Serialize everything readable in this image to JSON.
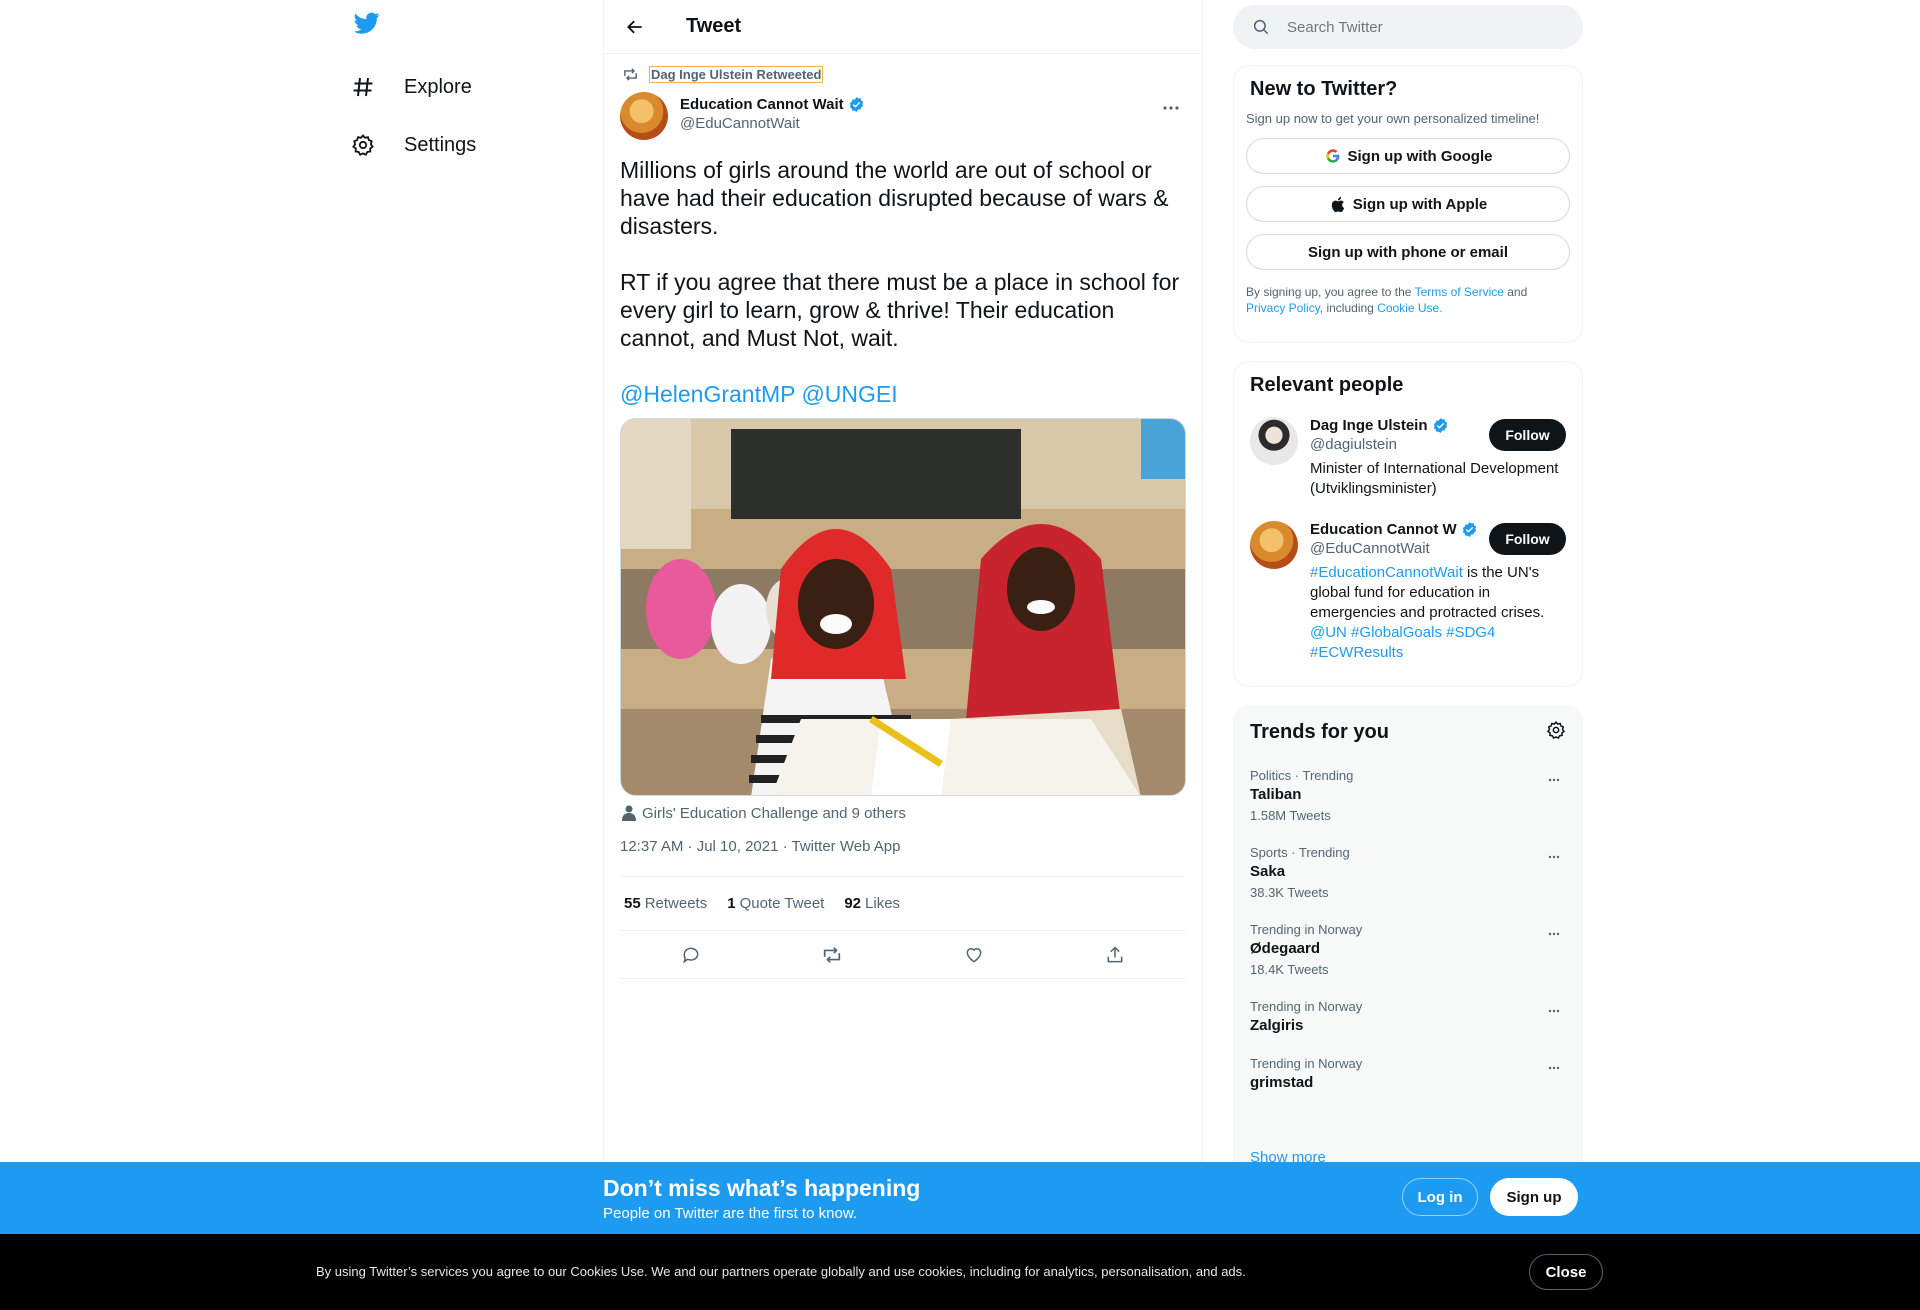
{
  "colors": {
    "accent": "#1d9bf0",
    "text": "#0f1419",
    "muted": "#536471"
  },
  "nav": {
    "logo_icon": "twitter-bird-icon",
    "items": [
      {
        "label": "Explore",
        "icon": "hashtag-icon"
      },
      {
        "label": "Settings",
        "icon": "gear-icon"
      }
    ]
  },
  "header": {
    "title": "Tweet",
    "back_icon": "arrow-left-icon"
  },
  "tweet": {
    "retweeted_by": "Dag Inge Ulstein Retweeted",
    "author_name": "Education Cannot Wait",
    "author_handle": "@EduCannotWait",
    "text": "Millions of girls around the world are out of school or have had their education disrupted because of wars & disasters.\n\nRT if you agree that there must be a place in school for every girl to learn, grow & thrive! Their education cannot, and Must Not, wait.",
    "mentions": [
      "@HelenGrantMP",
      "@UNGEI"
    ],
    "tagged": "Girls' Education Challenge and 9 others",
    "timestamp": "12:37 AM · Jul 10, 2021 · Twitter Web App",
    "stats": {
      "retweets_count": "55",
      "retweets_label": "Retweets",
      "quotes_count": "1",
      "quotes_label": "Quote Tweet",
      "likes_count": "92",
      "likes_label": "Likes"
    }
  },
  "search": {
    "placeholder": "Search Twitter"
  },
  "new_to_twitter": {
    "title": "New to Twitter?",
    "subtitle": "Sign up now to get your own personalized timeline!",
    "google": "Sign up with Google",
    "apple": "Sign up with Apple",
    "phone": "Sign up with phone or email",
    "terms_1": "By signing up, you agree to the ",
    "terms_link": "Terms of Service",
    "terms_2": " and ",
    "privacy_link": "Privacy Policy",
    "terms_3": ", including ",
    "cookie_link": "Cookie Use."
  },
  "relevant_people": {
    "title": "Relevant people",
    "people": [
      {
        "name": "Dag Inge Ulstein",
        "handle": "@dagiulstein",
        "bio": "Minister of International Development (Utviklingsminister)",
        "follow": "Follow"
      },
      {
        "name": "Education Cannot W",
        "handle": "@EduCannotWait",
        "bio_link": "#EducationCannotWait",
        "bio_text": " is the UN's global fund for education in emergencies and protracted crises.",
        "bio_tags": "@UN #GlobalGoals #SDG4",
        "bio_tags2": "#ECWResults",
        "follow": "Follow"
      }
    ]
  },
  "trends": {
    "title": "Trends for you",
    "items": [
      {
        "context": "Politics · Trending",
        "name": "Taliban",
        "count": "1.58M Tweets"
      },
      {
        "context": "Sports · Trending",
        "name": "Saka",
        "count": "38.3K Tweets"
      },
      {
        "context": "Trending in Norway",
        "name": "Ødegaard",
        "count": "18.4K Tweets"
      },
      {
        "context": "Trending in Norway",
        "name": "Zalgiris",
        "count": ""
      },
      {
        "context": "Trending in Norway",
        "name": "grimstad",
        "count": ""
      }
    ],
    "show_more": "Show more"
  },
  "signup_bar": {
    "title": "Don’t miss what’s happening",
    "subtitle": "People on Twitter are the first to know.",
    "login": "Log in",
    "signup": "Sign up"
  },
  "cookie_bar": {
    "text": "By using Twitter’s services you agree to our Cookies Use. We and our partners operate globally and use cookies, including for analytics, personalisation, and ads.",
    "close": "Close"
  }
}
